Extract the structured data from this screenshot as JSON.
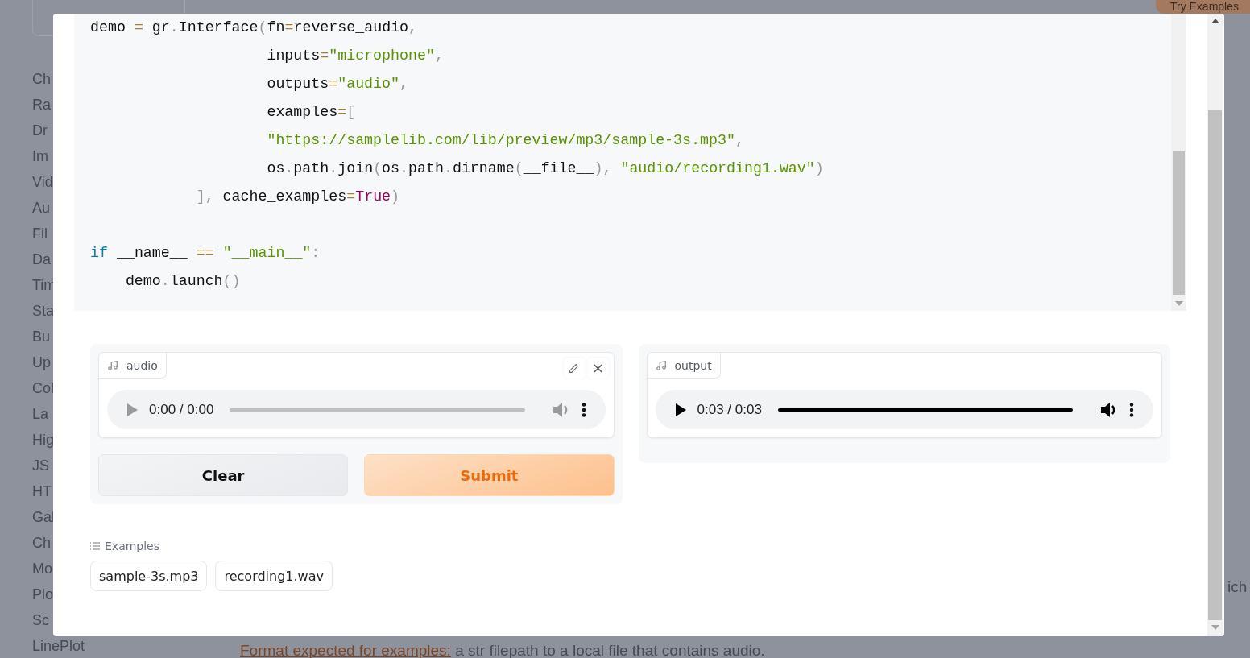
{
  "background": {
    "sidebar_items": [
      "Ch",
      "Ra",
      "Dr",
      "Im",
      "Vid",
      "Au",
      "Fil",
      "Da",
      "Tim",
      "Sta",
      "Bu",
      "Up",
      "Col",
      "La",
      "Hig",
      "JS",
      "HT",
      "Gal",
      "Ch",
      "Mo",
      "Plo",
      "Sc",
      "LinePlot"
    ],
    "try_examples_button": "Try Examples",
    "side_fragment": "ich",
    "footer_note": {
      "label": "Format expected for examples:",
      "text": " a str filepath to a local file that contains audio."
    }
  },
  "modal": {
    "code_blocks": [
      [
        "demo = gr.Interface(fn=reverse_audio,",
        "                    inputs=\"microphone\",",
        "                    outputs=\"audio\",",
        "                    examples=[",
        "                    \"https://samplelib.com/lib/preview/mp3/sample-3s.mp3\",",
        "                    os.path.join(os.path.dirname(__file__), \"audio/recording1.wav\")",
        "            ], cache_examples=True)"
      ],
      [
        "if __name__ == \"__main__\":",
        "    demo.launch()"
      ]
    ],
    "input_panel": {
      "label": "audio",
      "player": {
        "time": "0:00 / 0:00",
        "disabled": true,
        "level": 0
      },
      "buttons": [
        {
          "kind": "secondary",
          "label": "Clear"
        },
        {
          "kind": "primary",
          "label": "Submit"
        }
      ]
    },
    "output_panel": {
      "label": "output",
      "player": {
        "time": "0:03 / 0:03",
        "disabled": false,
        "level": 1
      }
    },
    "examples": {
      "title": "Examples",
      "items": [
        "sample-3s.mp3",
        "recording1.wav"
      ]
    }
  }
}
